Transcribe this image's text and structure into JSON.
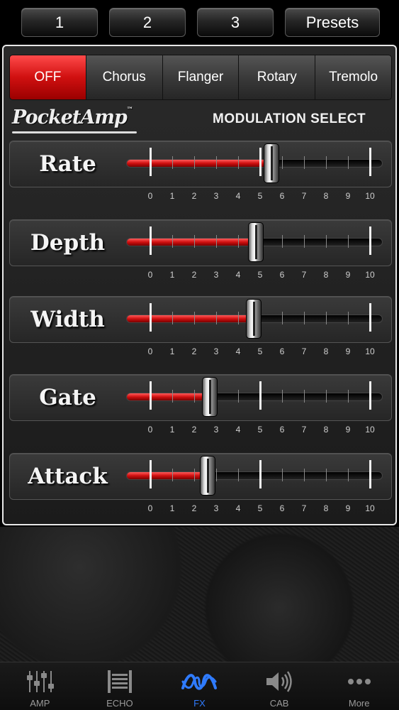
{
  "top_buttons": [
    {
      "label": "1"
    },
    {
      "label": "2"
    },
    {
      "label": "3"
    },
    {
      "label": "Presets"
    }
  ],
  "modulation": {
    "segments": [
      "OFF",
      "Chorus",
      "Flanger",
      "Rotary",
      "Tremolo"
    ],
    "selected": "OFF",
    "title": "MODULATION SELECT",
    "brand": "PocketAmp",
    "brand_tm": "™",
    "active_color": "#d01010"
  },
  "sliders": [
    {
      "label": "Rate",
      "value": 5.5
    },
    {
      "label": "Depth",
      "value": 4.8
    },
    {
      "label": "Width",
      "value": 4.7
    },
    {
      "label": "Gate",
      "value": 2.7
    },
    {
      "label": "Attack",
      "value": 2.6
    }
  ],
  "scale_labels": [
    "0",
    "1",
    "2",
    "3",
    "4",
    "5",
    "6",
    "7",
    "8",
    "9",
    "10"
  ],
  "tabs": [
    {
      "label": "AMP",
      "icon": "mixer-sliders-icon"
    },
    {
      "label": "ECHO",
      "icon": "echo-icon"
    },
    {
      "label": "FX",
      "icon": "fx-wave-icon",
      "active": true
    },
    {
      "label": "CAB",
      "icon": "speaker-icon"
    },
    {
      "label": "More",
      "icon": "more-dots-icon"
    }
  ],
  "tab_active_color": "#2f7bff"
}
